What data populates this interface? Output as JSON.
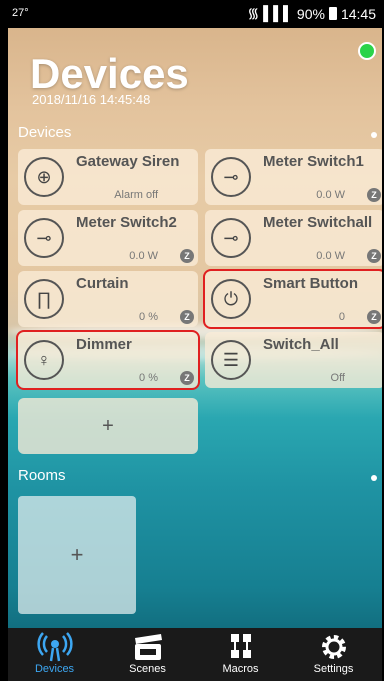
{
  "statusbar": {
    "left": "27°",
    "signal": "᯾ ▌▌▌",
    "battery": "90%",
    "time": "14:45"
  },
  "header": {
    "title": "Devices",
    "datetime": "2018/11/16 14:45:48"
  },
  "devices_section": {
    "label": "Devices"
  },
  "devices": [
    {
      "name": "Gateway Siren",
      "value": "Alarm off",
      "icon": "siren-icon",
      "zwave": false,
      "highlight": false
    },
    {
      "name": "Meter Switch1",
      "value": "0.0 W",
      "icon": "meter-switch-icon",
      "zwave": true,
      "highlight": false
    },
    {
      "name": "Meter Switch2",
      "value": "0.0 W",
      "icon": "meter-switch-icon",
      "zwave": true,
      "highlight": false
    },
    {
      "name": "Meter Switchall",
      "value": "0.0 W",
      "icon": "meter-switch-icon",
      "zwave": true,
      "highlight": false
    },
    {
      "name": "Curtain",
      "value": "0 %",
      "icon": "curtain-icon",
      "zwave": true,
      "highlight": false
    },
    {
      "name": "Smart Button",
      "value": "0",
      "icon": "smart-button-icon",
      "zwave": true,
      "highlight": true
    },
    {
      "name": "Dimmer",
      "value": "0 %",
      "icon": "bulb-icon",
      "zwave": true,
      "highlight": true
    },
    {
      "name": "Switch_All",
      "value": "Off",
      "icon": "switch-all-icon",
      "zwave": false,
      "highlight": false
    }
  ],
  "add_device": {
    "label": "+"
  },
  "rooms_section": {
    "label": "Rooms"
  },
  "add_room": {
    "label": "+"
  },
  "zwave_badge": "Z",
  "tabs": [
    {
      "label": "Devices",
      "icon": "devices-icon",
      "active": true
    },
    {
      "label": "Scenes",
      "icon": "clapper-icon",
      "active": false
    },
    {
      "label": "Macros",
      "icon": "macros-icon",
      "active": false
    },
    {
      "label": "Settings",
      "icon": "gear-icon",
      "active": false
    }
  ],
  "colors": {
    "accent": "#3da7f2",
    "online": "#2bd34a",
    "highlight": "#e02020"
  }
}
